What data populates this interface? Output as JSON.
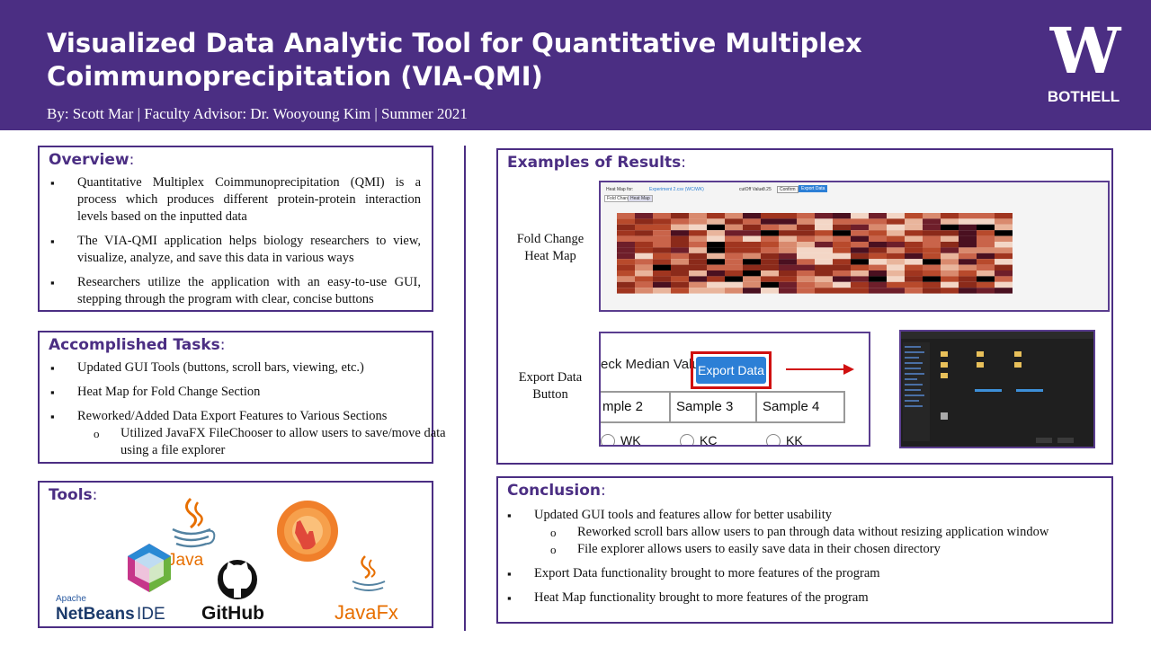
{
  "header": {
    "title": "Visualized Data Analytic Tool for Quantitative Multiplex Coimmunoprecipitation (VIA-QMI)",
    "byline": "By:  Scott Mar | Faculty Advisor: Dr. Wooyoung Kim | Summer 2021",
    "logo_letter": "W",
    "logo_text": "BOTHELL"
  },
  "overview": {
    "title": "Overview",
    "colon": ":",
    "items": [
      "Quantitative Multiplex Coimmunoprecipitation (QMI) is a process which produces different protein-protein interaction levels based on the inputted data",
      "The VIA-QMI application helps biology researchers to view, visualize, analyze, and save this data in various ways",
      "Researchers utilize the application with an easy-to-use GUI, stepping through the program with clear, concise buttons"
    ]
  },
  "tasks": {
    "title": "Accomplished Tasks",
    "colon": ":",
    "items": [
      "Updated GUI Tools (buttons, scroll bars, viewing, etc.)",
      "Heat Map for Fold Change Section",
      "Reworked/Added Data Export Features to Various Sections"
    ],
    "sub": "Utilized JavaFX FileChooser to allow users to save/move data using a file explorer"
  },
  "tools": {
    "title": "Tools",
    "colon": ":",
    "java_label": "Java",
    "netbeans_top": "Apache",
    "netbeans_main": "NetBeans",
    "netbeans_ide": "IDE",
    "github_label": "GitHub",
    "javafx_label": "JavaFx"
  },
  "results": {
    "title": "Examples of Results",
    "colon": ":",
    "heatmap_label_1": "Fold Change",
    "heatmap_label_2": "Heat Map",
    "export_label_1": "Export Data",
    "export_label_2": "Button",
    "export_button": "Export Data",
    "median_label": "eck Median Value:",
    "samples": [
      "mple 2",
      "Sample 3",
      "Sample 4"
    ],
    "radios": [
      "WK",
      "KC",
      "KK"
    ],
    "hm_tabs": [
      "Fold Change",
      "Heat Map"
    ],
    "hm_toolbar": [
      "Heat Map for:",
      "Experiment 2.csv (WC/WK)",
      "cutOff Value:",
      "0.25",
      "Confirm",
      "Export Data"
    ]
  },
  "conclusion": {
    "title": "Conclusion",
    "colon": ":",
    "item1": "Updated GUI tools and features allow for better usability",
    "sub1": "Reworked scroll bars allow users to pan through data without resizing application window",
    "sub2": "File explorer allows users to easily save data in their chosen directory",
    "item2": "Export Data functionality brought to more features of the program",
    "item3": "Heat Map functionality brought to more features of the program"
  },
  "colors": {
    "purple": "#4b2e83",
    "export_blue": "#2c7fd6",
    "highlight_red": "#d01010"
  }
}
